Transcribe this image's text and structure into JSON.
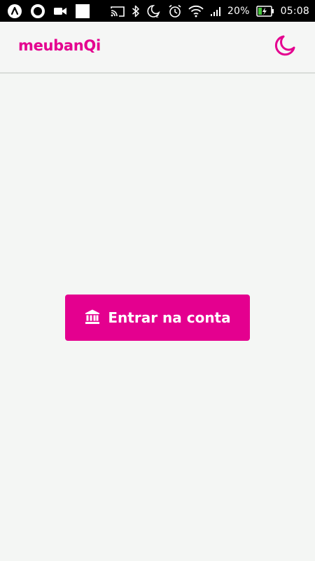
{
  "status_bar": {
    "battery_percent": "20%",
    "time": "05:08",
    "icons": [
      "app-icon",
      "circle-icon",
      "video-camera-icon",
      "square-icon",
      "cast-icon",
      "bluetooth-icon",
      "do-not-disturb-icon",
      "alarm-icon",
      "wifi-icon",
      "signal-icon",
      "battery-charging-icon"
    ]
  },
  "header": {
    "logo": "meubanQi",
    "theme_toggle_icon": "moon-icon"
  },
  "main": {
    "login_button": {
      "label": "Entrar na conta",
      "icon": "bank-icon"
    }
  },
  "colors": {
    "brand": "#e4008f",
    "background": "#f4f6f4",
    "status_bar": "#000000"
  }
}
